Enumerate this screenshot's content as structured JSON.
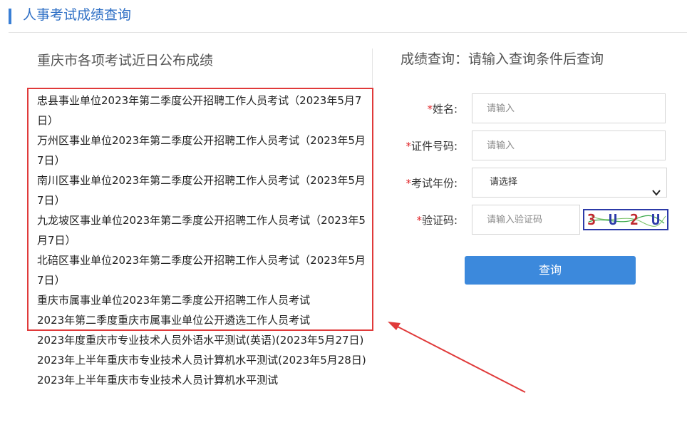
{
  "header": {
    "title": "人事考试成绩查询"
  },
  "left": {
    "title": "重庆市各项考试近日公布成绩",
    "items": [
      "忠县事业单位2023年第二季度公开招聘工作人员考试（2023年5月7日）",
      "万州区事业单位2023年第二季度公开招聘工作人员考试（2023年5月7日）",
      "南川区事业单位2023年第二季度公开招聘工作人员考试（2023年5月7日）",
      "九龙坡区事业单位2023年第二季度公开招聘工作人员考试（2023年5月7日）",
      "北碚区事业单位2023年第二季度公开招聘工作人员考试（2023年5月7日）",
      "重庆市属事业单位2023年第二季度公开招聘工作人员考试",
      "2023年第二季度重庆市属事业单位公开遴选工作人员考试",
      "2023年度重庆市专业技术人员外语水平测试(英语)(2023年5月27日)",
      "2023年上半年重庆市专业技术人员计算机水平测试(2023年5月28日)",
      "2023年上半年重庆市专业技术人员计算机水平测试"
    ]
  },
  "right": {
    "title": "成绩查询：请输入查询条件后查询",
    "star": "*",
    "name_label": "姓名:",
    "name_placeholder": "请输入",
    "id_label": "证件号码:",
    "id_placeholder": "请输入",
    "year_label": "考试年份:",
    "year_value": "请选择",
    "captcha_label": "验证码:",
    "captcha_placeholder": "请输入验证码",
    "captcha_chars": [
      "3",
      "U",
      "2",
      "U"
    ],
    "submit": "查询"
  },
  "colors": {
    "accent": "#3c89dc",
    "header_text": "#2e6fc5",
    "highlight_box": "#e03a3a",
    "required_star": "#e0262a"
  }
}
